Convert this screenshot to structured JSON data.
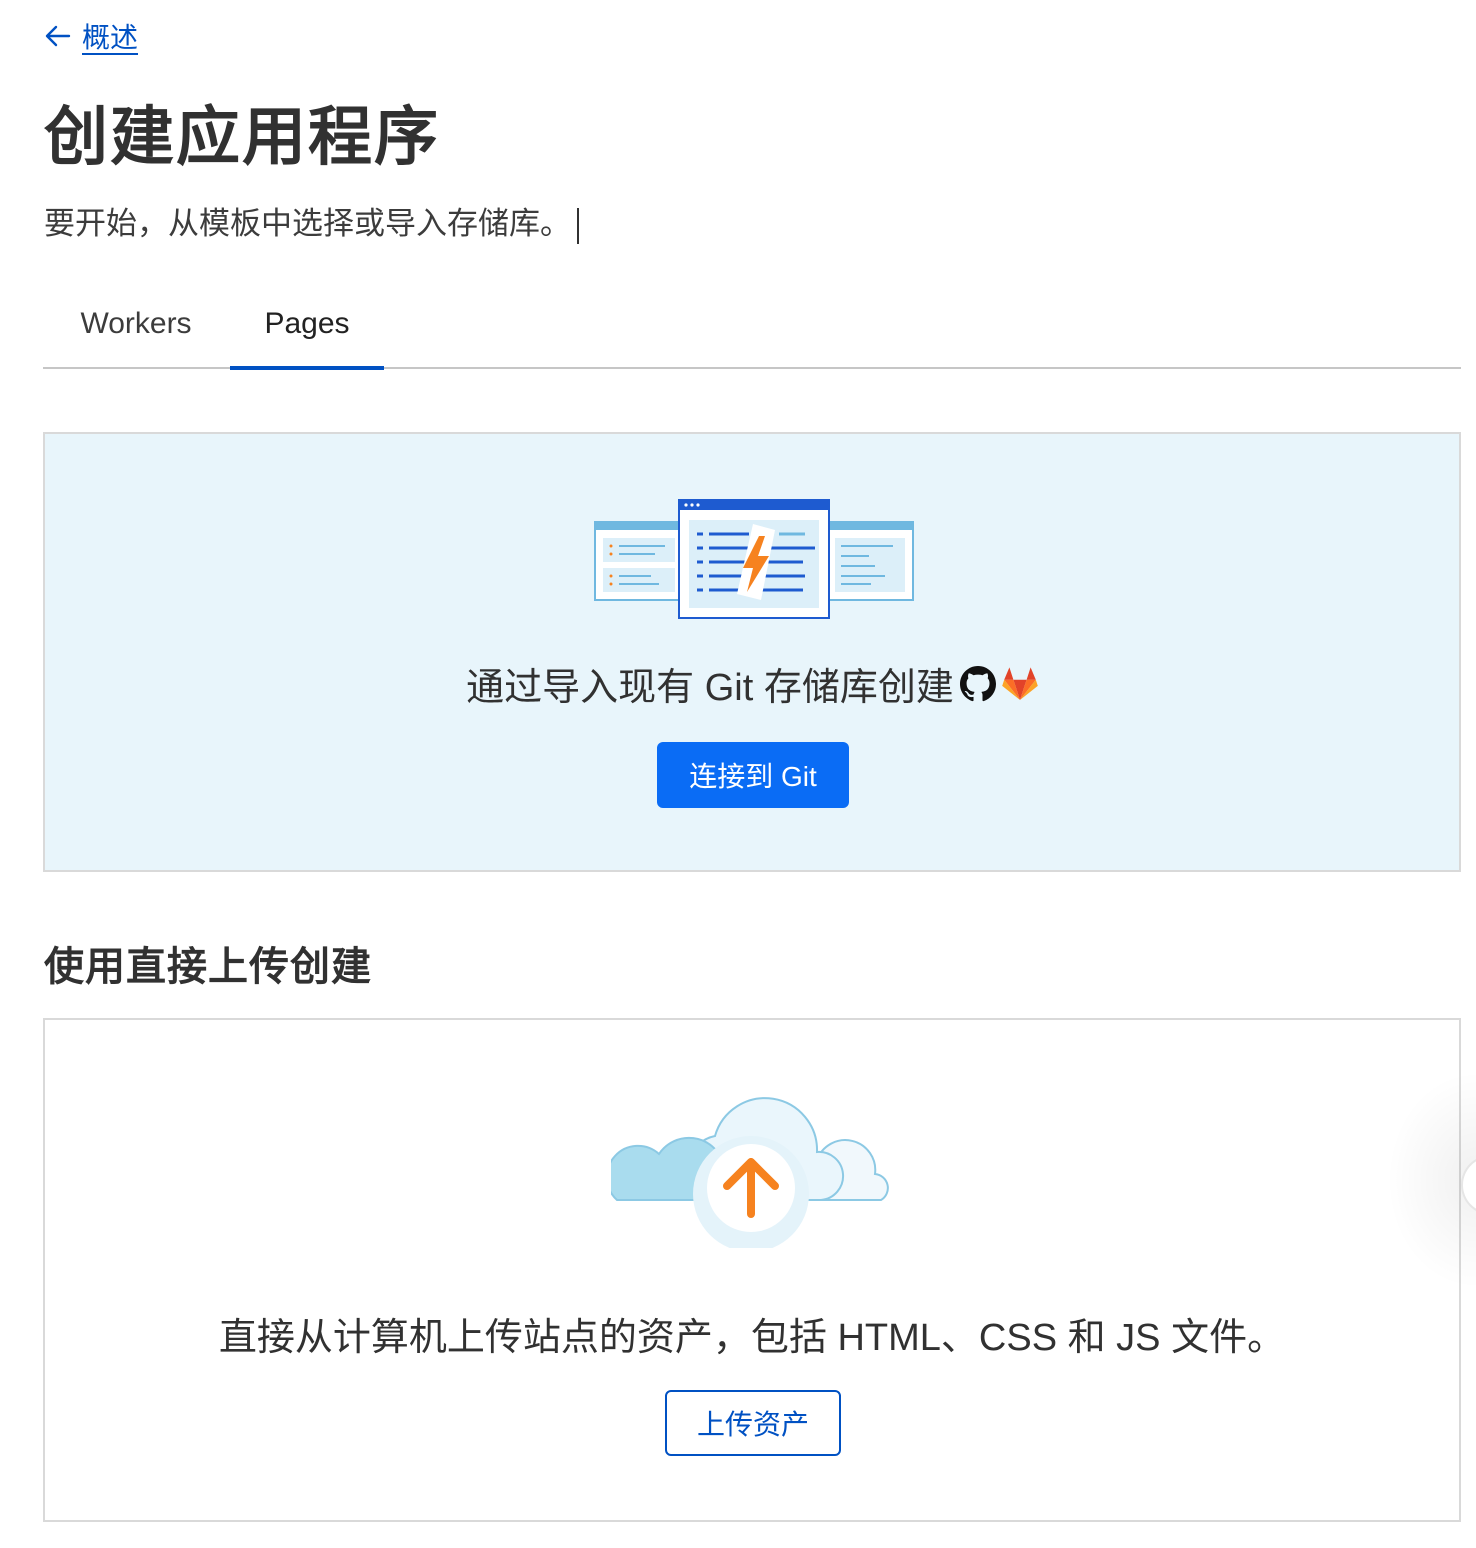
{
  "nav": {
    "back_label": "概述",
    "back_icon": "arrow-left-icon"
  },
  "header": {
    "title": "创建应用程序",
    "subtitle": "要开始，从模板中选择或导入存储库。"
  },
  "tabs": [
    {
      "label": "Workers",
      "selected": false
    },
    {
      "label": "Pages",
      "selected": true
    }
  ],
  "git_card": {
    "heading": "通过导入现有 Git 存储库创建",
    "icons": [
      "github-icon",
      "gitlab-icon"
    ],
    "button_label": "连接到 Git"
  },
  "upload_section": {
    "title": "使用直接上传创建",
    "description": "直接从计算机上传站点的资产，包括 HTML、CSS 和 JS 文件。",
    "button_label": "上传资产"
  },
  "colors": {
    "accent": "#0051c3",
    "primary_button": "#0a6cf5",
    "card_tint": "#e8f5fb",
    "orange": "#f6821f"
  }
}
